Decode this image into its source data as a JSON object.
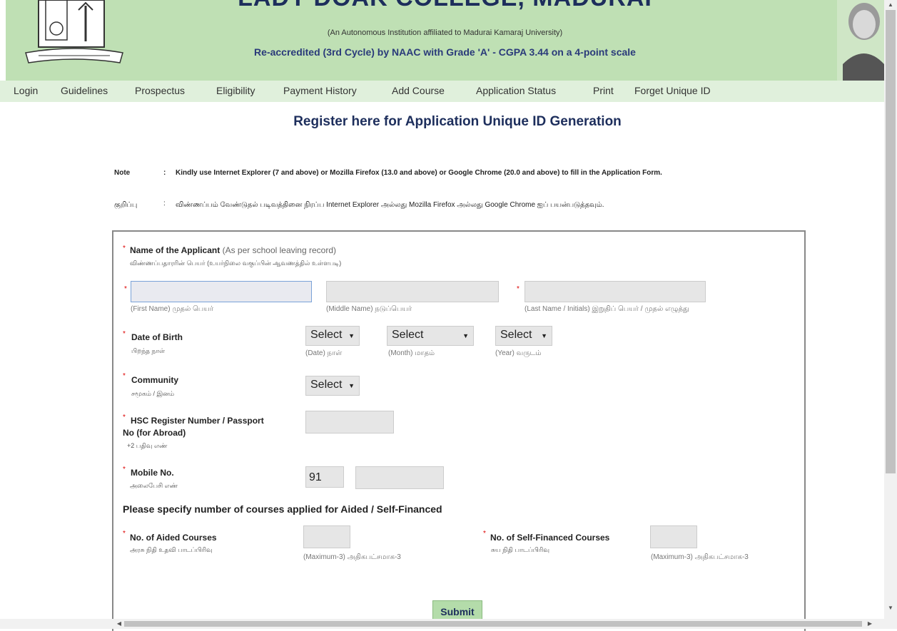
{
  "header": {
    "college_name": "LADY DOAK COLLEGE, MADURAI",
    "affiliation": "(An Autonomous Institution affiliated to Madurai Kamaraj University)",
    "accreditation": "Re-accredited (3rd Cycle) by NAAC with Grade 'A' - CGPA 3.44 on a 4-point scale",
    "bg_color": "#bfe0b4"
  },
  "nav": {
    "items": [
      "Login",
      "Guidelines",
      "Prospectus",
      "Eligibility",
      "Payment History",
      "Add Course",
      "Application Status",
      "Print",
      "Forget Unique ID"
    ]
  },
  "page_title": "Register here for Application Unique ID Generation",
  "note": {
    "label_en": "Note",
    "text_en": "Kindly use Internet Explorer (7 and above) or Mozilla Firefox (13.0 and above) or Google Chrome (20.0 and above) to fill in the Application Form.",
    "label_ta": "குறிப்பு",
    "text_ta": "விண்ணப்பம் வேண்டுதல் படிவத்தினை நிரப்ப Internet Explorer அல்லது Mozilla Firefox அல்லது Google Chrome ஐப் பயன்படுத்தவும்."
  },
  "form": {
    "name_label": "Name of the Applicant",
    "name_hint": "(As per school leaving record)",
    "name_ta": "விண்ணப்பதாரரின் பெயர் (உயர்நிலை வகுப்பின் ஆவணத்தில் உள்ளபடி)",
    "first_name_hint": "(First Name) முதல் பெயர்",
    "middle_name_hint": "(Middle Name) நடுப்பெயர்",
    "last_name_hint": "(Last Name / Initials) இறுதிப் பெயர் / முதல் எழுத்து",
    "dob_label": "Date of Birth",
    "dob_ta": "பிறந்த நாள்",
    "date_select": "Select",
    "month_select": "Select",
    "year_select": "Select",
    "date_hint": "(Date) நாள்",
    "month_hint": "(Month) மாதம்",
    "year_hint": "(Year) வருடம்",
    "community_label": "Community",
    "community_ta": "சமூகம் / இனம்",
    "community_select": "Select",
    "hsc_label_1": "HSC Register Number / Passport",
    "hsc_label_2": "No (for Abroad)",
    "hsc_ta": "+2 பதிவு எண்",
    "mobile_label": "Mobile No.",
    "mobile_ta": "அலைபேசி எண்",
    "mobile_code": "91",
    "courses_heading": "Please specify number of courses applied for Aided / Self-Financed",
    "aided_label": "No. of Aided Courses",
    "aided_ta": "அரசு நிதி உதவி பாடப்பிரிவு",
    "aided_hint": "(Maximum-3) அதிகபட்சமாக-3",
    "self_label": "No. of Self-Financed Courses",
    "self_ta": "சுய நிதி பாடப்பிரிவு",
    "self_hint": "(Maximum-3) அதிகபட்சமாக-3",
    "required_mark": "*",
    "submit_label": "Submit"
  }
}
